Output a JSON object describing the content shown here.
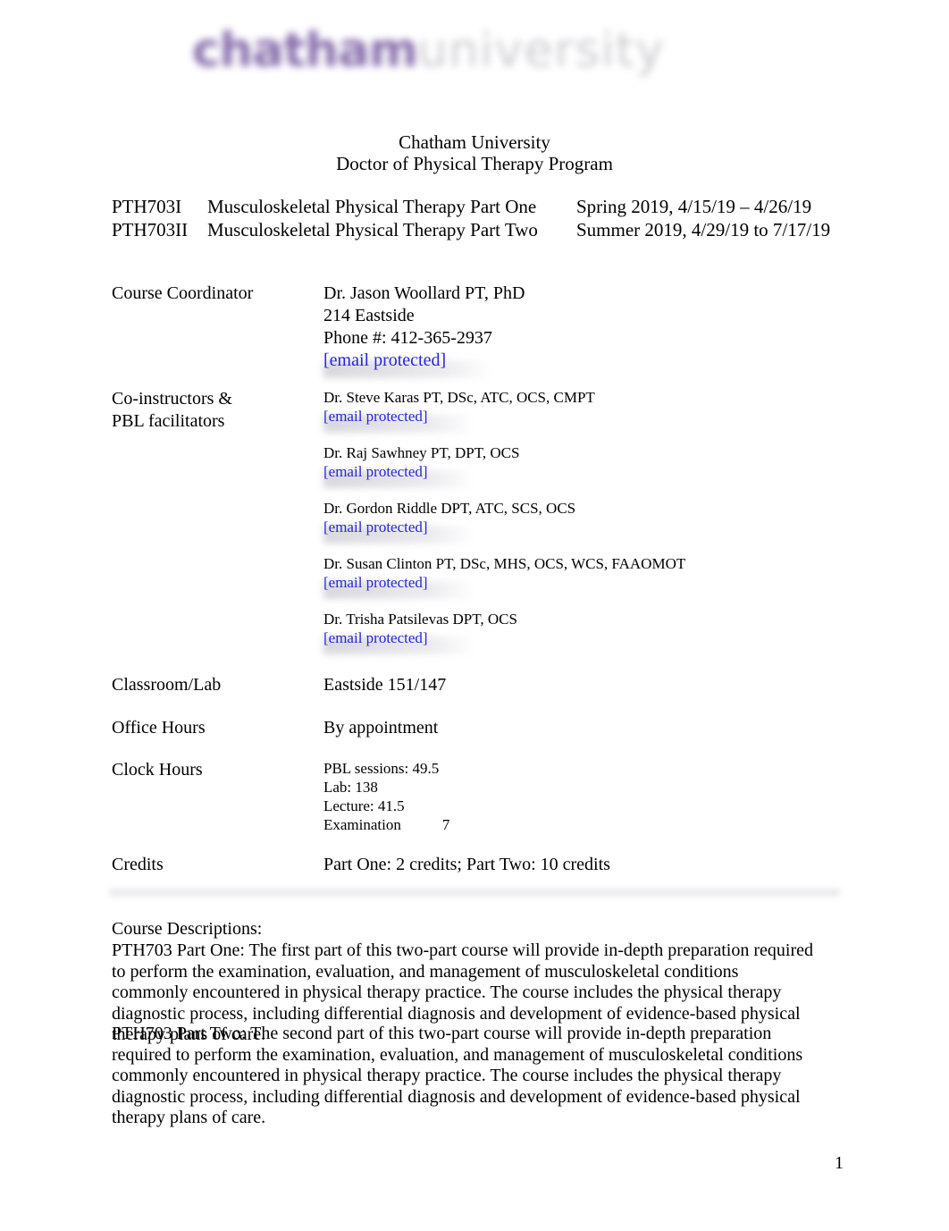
{
  "logo": {
    "brand": "chatham",
    "suffix": "university"
  },
  "header": {
    "institution": "Chatham University",
    "program": "Doctor of Physical Therapy Program"
  },
  "courses": [
    {
      "code": "PTH703I",
      "name": "Musculoskeletal Physical Therapy Part One",
      "term": "Spring 2019, 4/15/19 – 4/26/19"
    },
    {
      "code": "PTH703II",
      "name": "Musculoskeletal Physical Therapy Part Two",
      "term": "Summer 2019, 4/29/19 to 7/17/19"
    }
  ],
  "coordinator": {
    "label": "Course Coordinator",
    "name": "Dr. Jason Woollard PT, PhD",
    "office": "214 Eastside",
    "phone": "Phone #: 412-365-2937",
    "email": "[email protected]"
  },
  "coinstructors": {
    "label_line1": "Co-instructors &",
    "label_line2": "PBL facilitators",
    "people": [
      {
        "name": "Dr. Steve Karas PT, DSc, ATC, OCS, CMPT",
        "email": "[email protected]"
      },
      {
        "name": "Dr. Raj Sawhney PT, DPT, OCS",
        "email": "[email protected]"
      },
      {
        "name": "Dr. Gordon Riddle DPT, ATC, SCS, OCS",
        "email": "[email protected]"
      },
      {
        "name": "Dr. Susan Clinton PT, DSc, MHS, OCS, WCS, FAAOMOT",
        "email": "[email protected]"
      },
      {
        "name": "Dr. Trisha Patsilevas DPT, OCS",
        "email": "[email protected]"
      }
    ]
  },
  "classroom": {
    "label": "Classroom/Lab",
    "value": "Eastside 151/147"
  },
  "office_hours": {
    "label": "Office Hours",
    "value": "By appointment"
  },
  "clock_hours": {
    "label": "Clock Hours",
    "pbl": "PBL sessions: 49.5",
    "lab": "Lab: 138",
    "lecture": "Lecture: 41.5",
    "exam_label": "Examination",
    "exam_value": "7"
  },
  "credits": {
    "label": "Credits",
    "value": "Part One: 2 credits; Part Two: 10 credits"
  },
  "descriptions": {
    "heading": "Course Descriptions:",
    "part_one_label": "PTH703 Part One:",
    "part_one_text": "The first part of this two-part course will provide in-depth preparation required to perform the examination, evaluation, and management of musculoskeletal conditions commonly encountered in physical therapy practice. The course includes the physical therapy diagnostic process, including differential diagnosis and development of evidence-based physical therapy plans of care.",
    "part_two_label": "PTH703 Part Two:",
    "part_two_text": "The second part of this two-part course will provide in-depth preparation required to perform the examination, evaluation, and management of musculoskeletal conditions commonly encountered in physical therapy practice. The course includes the physical therapy diagnostic process, including differential diagnosis and development of evidence-based physical therapy plans of care."
  },
  "footer": {
    "page_number": "1"
  },
  "colors": {
    "link": "#2727d6",
    "brand_purple": "#7c5fa4",
    "brand_gray": "#c9c6cb"
  }
}
